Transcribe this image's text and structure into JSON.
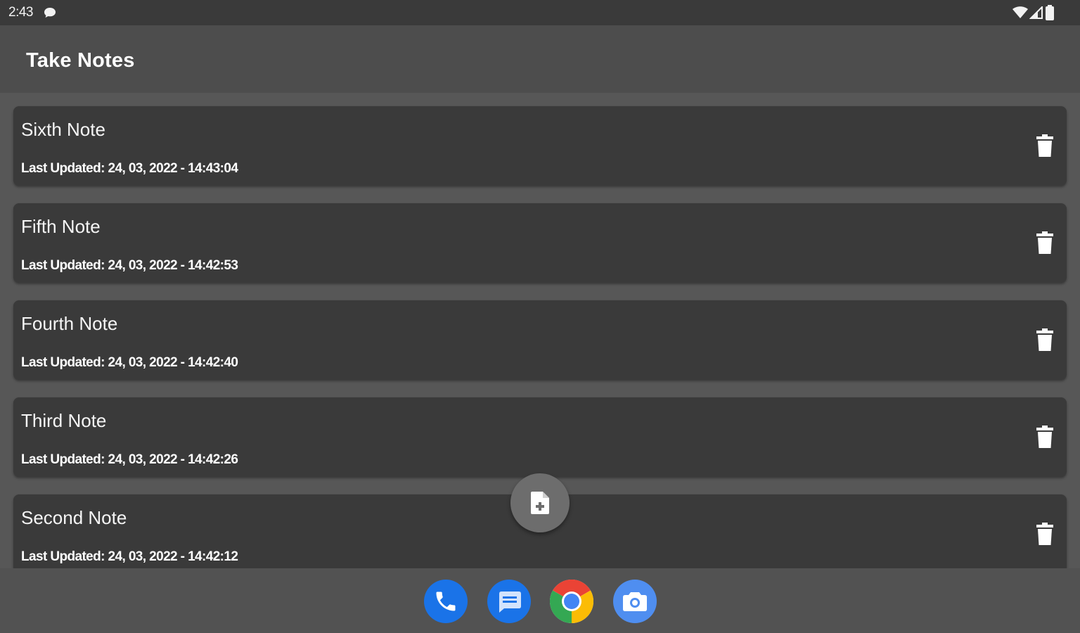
{
  "status_bar": {
    "time": "2:43",
    "icons": [
      "chat-icon",
      "wifi-icon",
      "signal-icon",
      "battery-icon"
    ]
  },
  "app_bar": {
    "title": "Take Notes"
  },
  "notes": [
    {
      "title": "Sixth Note",
      "updated": "Last Updated: 24, 03, 2022 - 14:43:04"
    },
    {
      "title": "Fifth Note",
      "updated": "Last Updated: 24, 03, 2022 - 14:42:53"
    },
    {
      "title": "Fourth Note",
      "updated": "Last Updated: 24, 03, 2022 - 14:42:40"
    },
    {
      "title": "Third Note",
      "updated": "Last Updated: 24, 03, 2022 - 14:42:26"
    },
    {
      "title": "Second Note",
      "updated": "Last Updated: 24, 03, 2022 - 14:42:12"
    }
  ],
  "fab": {
    "icon": "new-note-icon"
  },
  "dock": {
    "apps": [
      "phone-icon",
      "messages-icon",
      "chrome-icon",
      "camera-icon"
    ]
  },
  "colors": {
    "status_bar": "#3a3a3a",
    "app_bar": "#4d4d4d",
    "background": "#575757",
    "card": "#3a3a3a",
    "fab": "#6d6d6d",
    "dock_blue": "#1a73e8"
  }
}
